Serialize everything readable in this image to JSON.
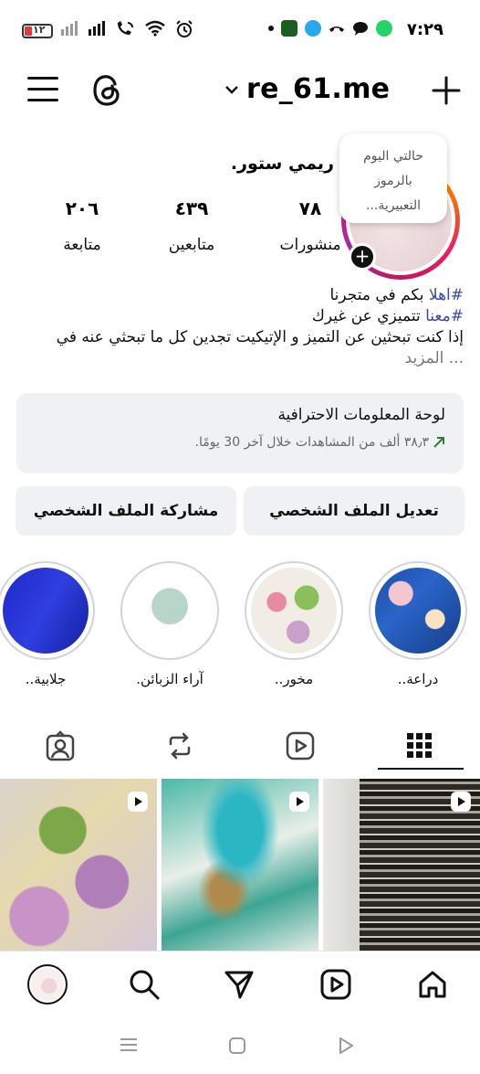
{
  "status_bar": {
    "battery_level": "١٢",
    "time": "٧:٢٩",
    "accent_battery_color": "#e53935",
    "icons_left": [
      "signal-icon",
      "signal-icon",
      "wifi-call-icon",
      "wifi-icon",
      "alarm-icon"
    ],
    "icons_right": [
      "dot-icon",
      "app-icon",
      "telegram-icon",
      "missed-call-icon",
      "chat-icon",
      "whatsapp-icon"
    ]
  },
  "header": {
    "username": "re_61.me",
    "menu_icon": "hamburger-icon",
    "threads_icon": "threads-icon",
    "create_icon": "plus-icon"
  },
  "profile": {
    "display_name": "ريمي ستور.",
    "note": {
      "line1": "حالتي اليوم",
      "line2": "بالرموز",
      "line3": "التعبيرية..."
    },
    "stats": [
      {
        "value": "٧٨",
        "label": "منشورات"
      },
      {
        "value": "٤٣٩",
        "label": "متابعين"
      },
      {
        "value": "٢٠٦",
        "label": "متابعة"
      }
    ],
    "bio": {
      "line1_tag": "#اهلا",
      "line1_text": " بكم في متجرنا",
      "line2_tag": "#معنا",
      "line2_text": " تتميزي عن غيرك",
      "line3": "إذا كنت تبحثين عن التميز و الإتيكيت تجدين كل ما تبحثي عنه في",
      "more": "... المزيد"
    }
  },
  "dashboard": {
    "title": "لوحة المعلومات الاحترافية",
    "subtitle": "٣٨٫٣ ألف من المشاهدات خلال آخر 30 يومًا.",
    "trend_color": "#2e7d32"
  },
  "buttons": {
    "edit": "تعديل الملف الشخصي",
    "share": "مشاركة الملف الشخصي"
  },
  "highlights": [
    {
      "label": "دراعة.."
    },
    {
      "label": "مخور.."
    },
    {
      "label": "آراء الزبائن."
    },
    {
      "label": "جلابية.."
    }
  ],
  "tabs": [
    "grid-icon",
    "reels-icon",
    "repost-icon",
    "tagged-icon"
  ],
  "bottom_nav": [
    "home-icon",
    "reels-icon",
    "send-icon",
    "search-icon",
    "profile-avatar"
  ],
  "system_nav": [
    "menu-icon",
    "home-square-icon",
    "back-triangle-icon"
  ]
}
